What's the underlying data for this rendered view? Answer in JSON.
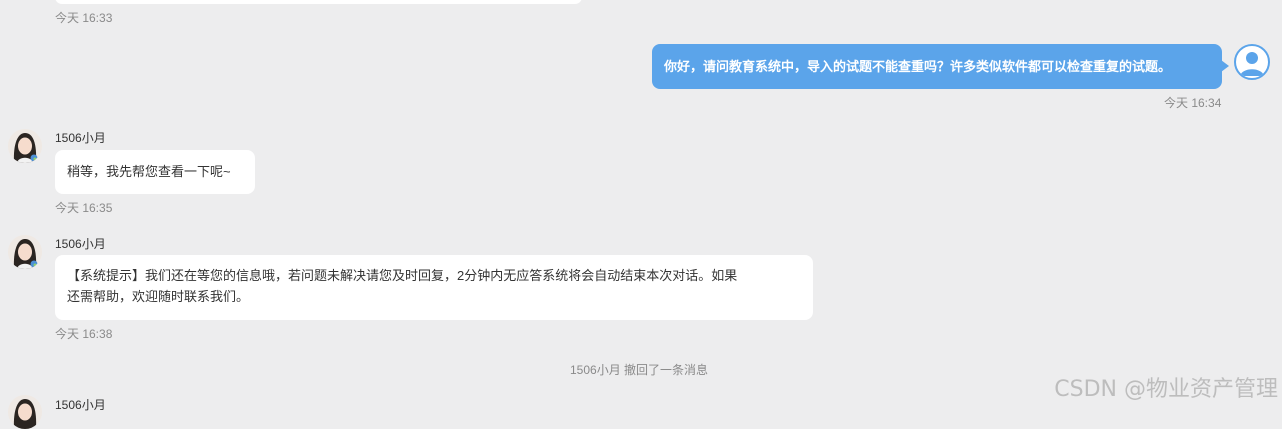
{
  "messages": {
    "prev_time": "今天 16:33",
    "user_msg": {
      "text": "你好，请问教育系统中，导入的试题不能查重吗？许多类似软件都可以检查重复的试题。",
      "time": "今天 16:34"
    },
    "agent_msg_1": {
      "name": "1506小月",
      "text": "稍等，我先帮您查看一下呢~",
      "time": "今天 16:35"
    },
    "agent_msg_2": {
      "name": "1506小月",
      "text_line1": "【系统提示】我们还在等您的信息哦，若问题未解决请您及时回复，2分钟内无应答系统将会自动结束本次对话。如果",
      "text_line2": "还需帮助，欢迎随时联系我们。",
      "time": "今天 16:38"
    },
    "recall_notice": "1506小月 撤回了一条消息",
    "agent_msg_3": {
      "name": "1506小月"
    }
  },
  "watermark": "CSDN @物业资产管理",
  "icons": {
    "agent_avatar": "agent-avatar-photo",
    "user_avatar": "user-avatar-icon"
  },
  "colors": {
    "user_bubble": "#5ba4ea",
    "background": "#ededee",
    "agent_bubble": "#ffffff"
  }
}
